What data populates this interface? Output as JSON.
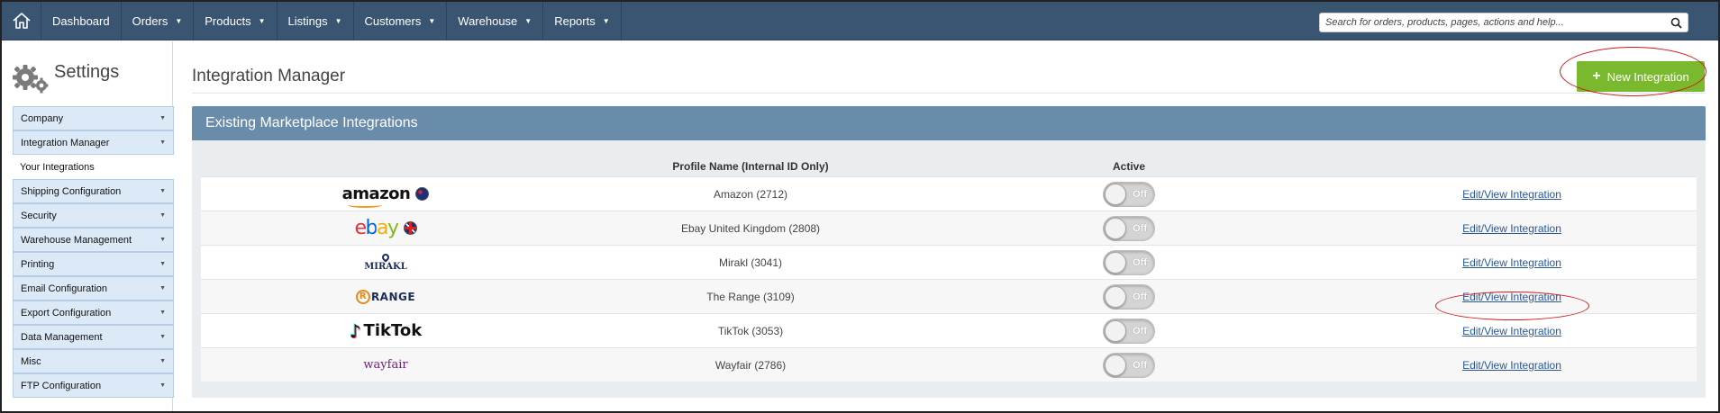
{
  "nav": {
    "items": [
      {
        "label": "Dashboard",
        "dropdown": false
      },
      {
        "label": "Orders",
        "dropdown": true
      },
      {
        "label": "Products",
        "dropdown": true
      },
      {
        "label": "Listings",
        "dropdown": true
      },
      {
        "label": "Customers",
        "dropdown": true
      },
      {
        "label": "Warehouse",
        "dropdown": true
      },
      {
        "label": "Reports",
        "dropdown": true
      }
    ],
    "search_placeholder": "Search for orders, products, pages, actions and help..."
  },
  "sidebar": {
    "title": "Settings",
    "items": [
      {
        "label": "Company",
        "type": "group"
      },
      {
        "label": "Integration Manager",
        "type": "group"
      },
      {
        "label": "Your Integrations",
        "type": "sub"
      },
      {
        "label": "Shipping Configuration",
        "type": "group"
      },
      {
        "label": "Security",
        "type": "group"
      },
      {
        "label": "Warehouse Management",
        "type": "group"
      },
      {
        "label": "Printing",
        "type": "group"
      },
      {
        "label": "Email Configuration",
        "type": "group"
      },
      {
        "label": "Export Configuration",
        "type": "group"
      },
      {
        "label": "Data Management",
        "type": "group"
      },
      {
        "label": "Misc",
        "type": "group"
      },
      {
        "label": "FTP Configuration",
        "type": "group"
      }
    ]
  },
  "main": {
    "title": "Integration Manager",
    "new_button_label": "New Integration",
    "panel_title": "Existing Marketplace Integrations",
    "columns": {
      "profile": "Profile Name (Internal ID Only)",
      "active": "Active"
    },
    "rows": [
      {
        "logo": "amazon",
        "logo_text": "amazon",
        "flag": "au",
        "name": "Amazon (2712)",
        "active": "Off",
        "link": "Edit/View Integration"
      },
      {
        "logo": "ebay",
        "logo_text": "ebay",
        "flag": "uk",
        "name": "Ebay United Kingdom (2808)",
        "active": "Off",
        "link": "Edit/View Integration"
      },
      {
        "logo": "mirakl",
        "logo_text": "MIRAKL",
        "name": "Mirakl (3041)",
        "active": "Off",
        "link": "Edit/View Integration"
      },
      {
        "logo": "range",
        "logo_text": "RANGE",
        "name": "The Range (3109)",
        "active": "Off",
        "link": "Edit/View Integration"
      },
      {
        "logo": "tiktok",
        "logo_text": "TikTok",
        "name": "TikTok (3053)",
        "active": "Off",
        "link": "Edit/View Integration"
      },
      {
        "logo": "wayfair",
        "logo_text": "wayfair",
        "name": "Wayfair (2786)",
        "active": "Off",
        "link": "Edit/View Integration"
      }
    ]
  },
  "colors": {
    "nav_bg": "#3a5572",
    "panel_header": "#6a8cab",
    "new_button": "#7ab82e",
    "highlight_ring": "#d01818",
    "link": "#2a5797"
  }
}
